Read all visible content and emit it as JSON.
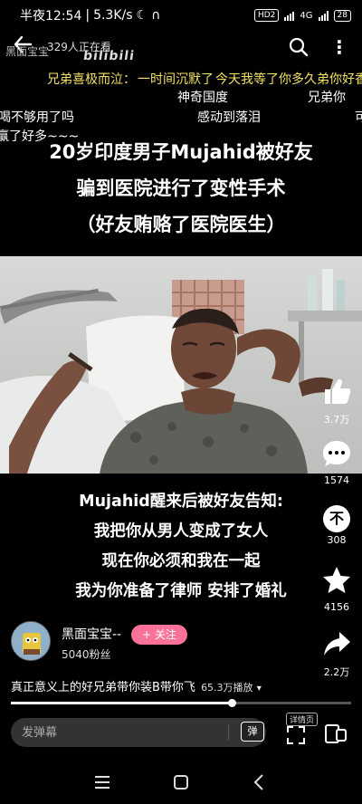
{
  "status_bar": {
    "time": "半夜12:54",
    "speed": "5.3K/s",
    "hd": "HD2",
    "network": "4G",
    "battery": "28"
  },
  "top_bar": {
    "uploader_short": "黑面宝宝",
    "viewers": "329人正在看",
    "logo": "bilibili",
    "icons": [
      "back-arrow-icon",
      "search-icon",
      "more-icon"
    ]
  },
  "danmaku": [
    {
      "text": "兄弟喜极而泣：",
      "color": "#f2e061"
    },
    {
      "text": "一时间沉默了",
      "color": "#f2e061"
    },
    {
      "text": "今天我等了你多久弟你好香",
      "color": "#f2e061"
    },
    {
      "text": "神奇国度",
      "color": "#ffffff"
    },
    {
      "text": "兄弟你",
      "color": "#ffffff"
    },
    {
      "text": "喝不够用了吗",
      "color": "#ffffff"
    },
    {
      "text": "感动到落泪",
      "color": "#ffffff"
    },
    {
      "text": "可",
      "color": "#ffffff"
    },
    {
      "text": "赢了好多~~~",
      "color": "#ffffff"
    }
  ],
  "title_lines": [
    "20岁印度男子Mujahid被好友",
    "骗到医院进行了变性手术",
    "（好友贿赂了医院医生）"
  ],
  "subtitle_lines": [
    "Mujahid醒来后被好友告知:",
    "我把你从男人变成了女人",
    "现在你必须和我在一起",
    "我为你准备了律师 安排了婚礼"
  ],
  "rail": {
    "like_count": "3.7万",
    "comment_count": "1574",
    "dislike_label": "不",
    "dislike_count": "308",
    "favorite_count": "4156",
    "share_count": "2.2万"
  },
  "uploader": {
    "name": "黑面宝宝--",
    "fans": "5040粉丝",
    "follow_label": "+ 关注"
  },
  "video": {
    "title": "真正意义上的好兄弟带你装B带你飞",
    "plays": "65.3万播放",
    "progress": 0.65
  },
  "bottom": {
    "danmaku_placeholder": "发弹幕",
    "danmaku_toggle": "弹",
    "detail_label": "详情页"
  },
  "colors": {
    "accent": "#fb7299",
    "danmaku_yellow": "#f2e061",
    "background": "#000000"
  }
}
